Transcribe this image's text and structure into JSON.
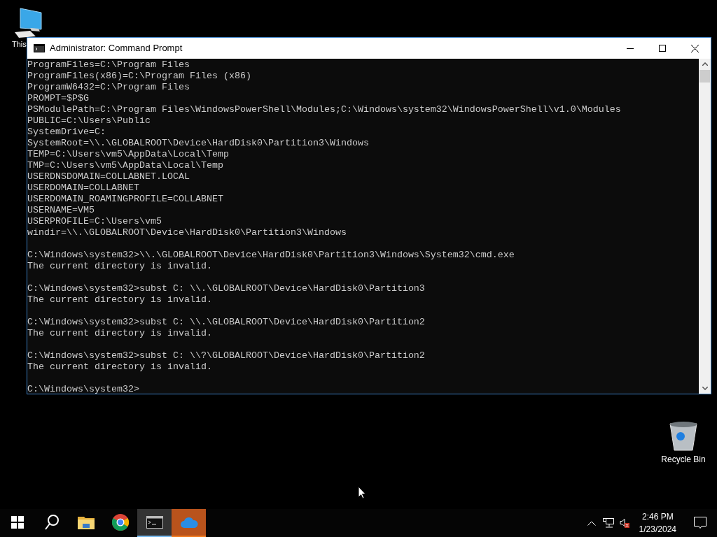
{
  "desktop_icons": [
    {
      "kind": "computer",
      "label": "This"
    },
    {
      "kind": "recycle-bin",
      "label": "Recycle Bin"
    }
  ],
  "window": {
    "title": "Administrator: Command Prompt",
    "blocks": [
      [
        "ProgramFiles=C:\\Program Files",
        "ProgramFiles(x86)=C:\\Program Files (x86)",
        "ProgramW6432=C:\\Program Files",
        "PROMPT=$P$G",
        "PSModulePath=C:\\Program Files\\WindowsPowerShell\\Modules;C:\\Windows\\system32\\WindowsPowerShell\\v1.0\\Modules",
        "PUBLIC=C:\\Users\\Public",
        "SystemDrive=C:",
        "SystemRoot=\\\\.\\GLOBALROOT\\Device\\HardDisk0\\Partition3\\Windows",
        "TEMP=C:\\Users\\vm5\\AppData\\Local\\Temp",
        "TMP=C:\\Users\\vm5\\AppData\\Local\\Temp",
        "USERDNSDOMAIN=COLLABNET.LOCAL",
        "USERDOMAIN=COLLABNET",
        "USERDOMAIN_ROAMINGPROFILE=COLLABNET",
        "USERNAME=VM5",
        "USERPROFILE=C:\\Users\\vm5",
        "windir=\\\\.\\GLOBALROOT\\Device\\HardDisk0\\Partition3\\Windows"
      ],
      [
        "C:\\Windows\\system32>\\\\.\\GLOBALROOT\\Device\\HardDisk0\\Partition3\\Windows\\System32\\cmd.exe",
        "The current directory is invalid."
      ],
      [
        "C:\\Windows\\system32>subst C: \\\\.\\GLOBALROOT\\Device\\HardDisk0\\Partition3",
        "The current directory is invalid."
      ],
      [
        "C:\\Windows\\system32>subst C: \\\\.\\GLOBALROOT\\Device\\HardDisk0\\Partition2",
        "The current directory is invalid."
      ],
      [
        "C:\\Windows\\system32>subst C: \\\\?\\GLOBALROOT\\Device\\HardDisk0\\Partition2",
        "The current directory is invalid."
      ],
      [
        "C:\\Windows\\system32>"
      ]
    ]
  },
  "taskbar": {
    "apps": [
      {
        "kind": "start",
        "selected": false,
        "flashing": false
      },
      {
        "kind": "search",
        "selected": false,
        "flashing": false
      },
      {
        "kind": "folder",
        "selected": false,
        "flashing": false
      },
      {
        "kind": "browser",
        "selected": false,
        "flashing": false
      },
      {
        "kind": "terminal",
        "selected": true,
        "flashing": false
      },
      {
        "kind": "cloud",
        "selected": false,
        "flashing": true
      }
    ],
    "volume_muted": true,
    "time": "2:46 PM",
    "date": "1/23/2024"
  }
}
